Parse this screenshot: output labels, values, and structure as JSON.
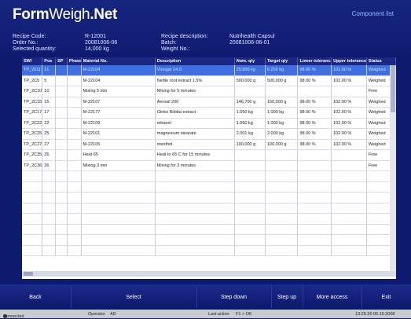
{
  "app": {
    "logo_bold": "Form",
    "logo_thin": "Weigh",
    "logo_end": ".Net",
    "top_right": "Component list"
  },
  "recipe_info": {
    "left_labels": [
      "Recipe Code:",
      "Order No.:",
      "Selected quantity:"
    ],
    "left_values": [
      "R-12001",
      "20081006-06",
      "14,000 kg"
    ],
    "right_labels": [
      "Recipe description:",
      "Batch:",
      "Weight No.:"
    ],
    "right_values": [
      "Nutrihealth Capsul",
      "20081006-06-01",
      ""
    ]
  },
  "table": {
    "headers": [
      "SWI",
      "Pos",
      "SP",
      "Phase",
      "Material No.",
      "Description",
      "Nom. qty",
      "Target qty",
      "Lower tolerance",
      "Upper tolerance",
      "Status"
    ],
    "rows": [
      [
        "TP_2011",
        "21",
        "",
        "",
        "M-22104",
        "Vinegar 24.0",
        "25.000 kg",
        "6.250 kg",
        "98.00 %",
        "102.00 %",
        "Weighed"
      ],
      [
        "TP_2C5",
        "5",
        "",
        "",
        "M-22104",
        "Nettle root extract 1.5%",
        "500,000 g",
        "500,000 g",
        "98.00 %",
        "102.00 %",
        "Weighed"
      ],
      [
        "TP_2C10",
        "10",
        "",
        "",
        "Mixing 5 min",
        "Mixing for 5 minutes",
        "",
        "",
        "",
        "",
        "Free"
      ],
      [
        "TP_2C15",
        "15",
        "",
        "",
        "M-22107",
        "Aerosil 200",
        "146,700 g",
        "150,000 g",
        "98.00 %",
        "102.00 %",
        "Weighed"
      ],
      [
        "TP_2C17",
        "17",
        "",
        "",
        "M-22177",
        "Ginko Biloba extract",
        "1.050 kg",
        "1.000 kg",
        "98.00 %",
        "102.00 %",
        "Weighed"
      ],
      [
        "TP_2C22",
        "22",
        "",
        "",
        "M-22109",
        "ethanol",
        "1.050 kg",
        "1.000 kg",
        "98.00 %",
        "102.00 %",
        "Weighed"
      ],
      [
        "TP_2C25",
        "25",
        "",
        "",
        "M-22101",
        "magnesium stearate",
        "2.001 kg",
        "2.000 kg",
        "98.00 %",
        "102.00 %",
        "Weighed"
      ],
      [
        "TP_2C27",
        "27",
        "",
        "",
        "M-22105",
        "menthol",
        "100,000 g",
        "100,000 g",
        "98.00 %",
        "102.00 %",
        "Weighed"
      ],
      [
        "TP_2C35",
        "35",
        "",
        "",
        "Heat 65",
        "Heat to 65 C for 15 minutes",
        "",
        "",
        "",
        "",
        "Free"
      ],
      [
        "TP_2C36",
        "36",
        "",
        "",
        "Mixing 3 min",
        "Mixing for 3 minutes",
        "",
        "",
        "",
        "",
        "Free"
      ]
    ]
  },
  "buttons": [
    "Back",
    "Select",
    "Step down",
    "Step up",
    "More access",
    "Exit"
  ],
  "status_bar": {
    "connection": "Connected",
    "user_label": "Operator",
    "user": "AD",
    "last_action": "Last action",
    "last_action_value": "F1 > OK",
    "datetime": "13:25:36  06.10.2008"
  }
}
